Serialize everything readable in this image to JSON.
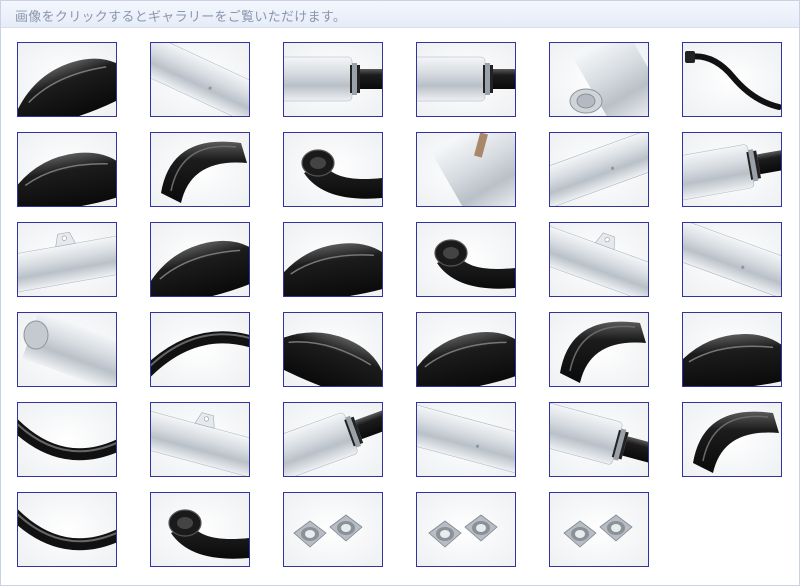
{
  "header": {
    "instruction": "画像をクリックするとギャラリーをご覧いただけます。"
  },
  "gallery": {
    "thumbnails": [
      {
        "subject": "black-exhaust-pipe"
      },
      {
        "subject": "silver-silencer-tube"
      },
      {
        "subject": "silver-silencer-clamp"
      },
      {
        "subject": "silencer-joint-black"
      },
      {
        "subject": "silencer-end-cap"
      },
      {
        "subject": "thin-black-pipe"
      },
      {
        "subject": "black-chamber-stay"
      },
      {
        "subject": "black-curved-chamber"
      },
      {
        "subject": "black-pipe-joint"
      },
      {
        "subject": "silencer-titanium-outlet"
      },
      {
        "subject": "silencer-body-closeup"
      },
      {
        "subject": "silencer-black-clamp"
      },
      {
        "subject": "silencer-bracket"
      },
      {
        "subject": "black-chamber-side"
      },
      {
        "subject": "black-chamber-bulge"
      },
      {
        "subject": "black-manifold-flange"
      },
      {
        "subject": "silencer-bracket-angle"
      },
      {
        "subject": "silencer-rivet-detail"
      },
      {
        "subject": "silencer-tip-silver"
      },
      {
        "subject": "black-pipe-curve-stay"
      },
      {
        "subject": "black-pipe-flat"
      },
      {
        "subject": "black-chamber-welds"
      },
      {
        "subject": "black-chamber-large"
      },
      {
        "subject": "black-chamber-shape"
      },
      {
        "subject": "black-pipe-rubber-joint"
      },
      {
        "subject": "silencer-bracket-top"
      },
      {
        "subject": "silencer-with-clamp"
      },
      {
        "subject": "silencer-body-plain"
      },
      {
        "subject": "silver-pipe-black-joint"
      },
      {
        "subject": "black-chamber-front"
      },
      {
        "subject": "black-pipe-bend"
      },
      {
        "subject": "black-flange-pipe"
      },
      {
        "subject": "silver-flange-pair"
      },
      {
        "subject": "silver-flange-pair-angle"
      },
      {
        "subject": "silver-flange-pair-top"
      }
    ]
  },
  "colors": {
    "thumbnail_border": "#3333a0",
    "header_text": "#8a96ad",
    "header_background": "#e9eef8"
  }
}
